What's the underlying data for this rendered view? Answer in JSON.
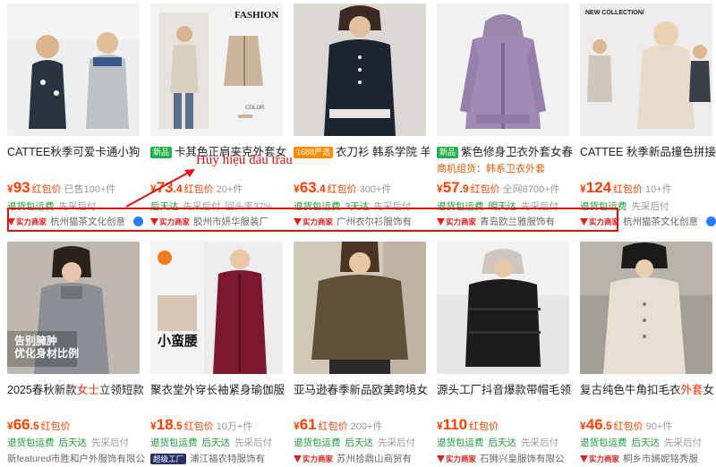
{
  "annotation": {
    "label": "Huy hiệu đầu trâu",
    "color": "#e01010"
  },
  "colors": {
    "price": "#ff4000",
    "service_green": "#1a9a3a",
    "muted": "#999999",
    "badge_red": "#e0211f",
    "tag_green": "#25b04a",
    "tag_orange": "#ff8a00"
  },
  "row1": [
    {
      "title_pre": "",
      "title_hl": "",
      "title_post": "CATTEE秋季可爱卡通小狗",
      "tag": "",
      "price_int": "93",
      "price_dec": "",
      "price_label": "红包价",
      "sold": "已售100+件",
      "services": [
        "退货包运费",
        "先采后付"
      ],
      "store": "杭州猫茶文化创意"
    },
    {
      "title_pre": "",
      "title_hl": "",
      "title_post": "卡其色正肩夹克外套女",
      "tag": "新品",
      "price_int": "73",
      "price_dec": ".4",
      "price_label": "红包价",
      "sold": "20+件",
      "services": [
        "后天达",
        "先采后付",
        "回头率37%"
      ],
      "store": "胶州市妍华服装厂"
    },
    {
      "title_pre": "",
      "title_hl": "",
      "title_post": "衣刀衫 韩系学院 羊",
      "tag": "1688严选",
      "price_int": "63",
      "price_dec": ".4",
      "price_label": "红包价",
      "sold": "300+件",
      "services": [
        "退货包运费",
        "3天达",
        "先采后付"
      ],
      "store": "广州衣尔衫服饰有"
    },
    {
      "title_pre": "",
      "title_hl": "",
      "title_post": "紫色修身卫衣外套女春",
      "tag": "新品",
      "price_int": "57",
      "price_dec": ".9",
      "price_label": "红包价",
      "sold": "全网8700+件",
      "sub": "商机组货：韩系卫衣外套",
      "services": [
        "退货包运费",
        "明天达",
        "先采后付"
      ],
      "store": "青岛欧兰雅服饰有"
    },
    {
      "title_pre": "",
      "title_hl": "",
      "title_post": "CATTEE 秋季新品撞色拼接",
      "tag": "",
      "price_int": "124",
      "price_dec": "",
      "price_label": "红包价",
      "sold": "10+件",
      "services": [
        "退货包运费",
        "先采后付"
      ],
      "store": "杭州猫茶文化创意"
    }
  ],
  "row2": [
    {
      "title_pre": "2025春秋新款",
      "title_hl": "女士",
      "title_post": "立领短款",
      "tag": "",
      "price_int": "66",
      "price_dec": ".5",
      "price_label": "红包价",
      "sold": "",
      "services": [
        "退货包运费",
        "后天达",
        "先采后付"
      ],
      "store": "新featured市胜和户外服饰有限公",
      "store_type": "none",
      "overlay": [
        "告别臃肿",
        "优化身材比例"
      ]
    },
    {
      "title_pre": "聚衣堂外穿长袖紧身瑜伽服",
      "title_hl": "",
      "title_post": "",
      "tag": "",
      "price_int": "18",
      "price_dec": ".5",
      "price_label": "红包价",
      "sold": "10万+件",
      "services": [
        "退货包运费",
        "后天达",
        "先采后付"
      ],
      "store": "浦江福农特服饰有",
      "store_type": "ent",
      "overlay": [
        "小蛮腰"
      ]
    },
    {
      "title_pre": "亚马逊春季新品欧美跨境女",
      "title_hl": "",
      "title_post": "",
      "tag": "",
      "price_int": "61",
      "price_dec": "",
      "price_label": "红包价",
      "sold": "200+件",
      "services": [
        "退货包运费",
        "后天达",
        "先采后付"
      ],
      "store": "苏州拾鼎山商贸有",
      "store_type": "power"
    },
    {
      "title_pre": "源头工厂抖音爆款带帽毛领",
      "title_hl": "",
      "title_post": "",
      "tag": "",
      "price_int": "110",
      "price_dec": "",
      "price_label": "红包价",
      "sold": "",
      "services": [
        "退货包运费",
        "后天达",
        "先采后付"
      ],
      "store": "石狮兴皇服饰有限公",
      "store_type": "power"
    },
    {
      "title_pre": "复古纯色牛角扣毛衣",
      "title_hl": "外套",
      "title_post": "女",
      "tag": "",
      "price_int": "46",
      "price_dec": ".5",
      "price_label": "红包价",
      "sold": "90+件",
      "services": [
        "退货包运费",
        "后天达",
        "先采后付"
      ],
      "store": "桐乡市嫣妮铭秀服",
      "store_type": "power"
    }
  ],
  "store_badge_label": "实力商家",
  "ent_badge_label": "超级工厂"
}
